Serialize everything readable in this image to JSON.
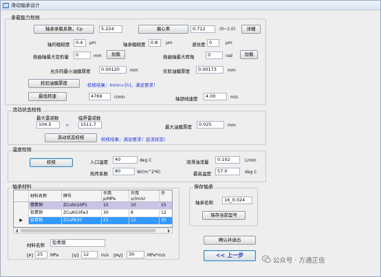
{
  "window": {
    "title": "滑动轴承设计"
  },
  "load": {
    "group_title": "承载能力校核",
    "coef_button": "轴承承载系数，Cp",
    "coef_value": "5.224",
    "ecc_button": "偏心率",
    "ecc_value": "0.712",
    "ecc_range": "(0~1.0)",
    "detail_button": "详细",
    "shaft_rough_label": "轴的粗糙度",
    "shaft_rough_value": "0.4",
    "shaft_rough_unit": "μm",
    "bore_rough_label": "轴承粗糙度",
    "bore_rough_value": "0.8",
    "bore_rough_unit": "μm",
    "wave_label": "波纹度",
    "wave_value": "0",
    "wave_unit": "μm",
    "deform_label": "挠曲轴最大变形量",
    "deform_value": "0",
    "deform_unit": "mm",
    "deform_button": "加载",
    "tilt_label": "挠曲轴最大转角",
    "tilt_value": "0",
    "tilt_unit": "rad",
    "tilt_button": "加载",
    "hmin_allow_label": "允许的最小油膜厚度",
    "hmin_allow_value": "0.00120",
    "hmin_allow_unit": "mm",
    "hmin_actual_label": "实际油膜厚度",
    "hmin_actual_value": "0.00173",
    "hmin_actual_unit": "mm",
    "check_button": "校验油膜厚度",
    "check_result": "校核结果：hmin>[h]，满足要求！",
    "min_speed_button": "最低转速",
    "min_speed_value": "4769",
    "min_speed_unit": "r/min",
    "neck_speed_label": "轴颈线速度",
    "neck_speed_value": "4.00",
    "neck_speed_unit": "m/s"
  },
  "flow": {
    "group_title": "流动状态校核",
    "re_max_label": "最大雷诺数",
    "re_max_value": "104.5",
    "lt_sign": "<",
    "re_crit_label": "临界雷诺数",
    "re_crit_value": "1511.7",
    "film_max_label": "最大油膜厚度",
    "film_max_value": "0.025",
    "film_max_unit": "mm",
    "check_button": "流动状态校核",
    "check_result": "校核结果：满足要求！层流状态！"
  },
  "temp": {
    "group_title": "温度校核",
    "check_button": "校核",
    "inlet_label": "入口温度",
    "inlet_value": "40",
    "inlet_unit": "deg C",
    "lube_flow_label": "润滑油流量",
    "lube_flow_value": "0.102",
    "lube_flow_unit": "L/min",
    "heat_coef_label": "热传系数",
    "heat_coef_value": "80",
    "heat_coef_unit": "W/(m^2*K)",
    "max_temp_label": "最高温度",
    "max_temp_value": "57.0",
    "max_temp_unit": "deg C"
  },
  "material": {
    "group_title": "轴承材料",
    "columns": [
      "材料名称",
      "牌号",
      "许用\np/MPa",
      "许用\nv/(m/s)",
      "许"
    ],
    "rows": [
      {
        "marker": "",
        "name": "锡青铜",
        "grade": "ZCuSn10P1",
        "p": "15",
        "v": "10",
        "extra": "15"
      },
      {
        "marker": "",
        "name": "铝青铜",
        "grade": "ZCuAl10Fe3",
        "p": "30",
        "v": "8",
        "extra": "12"
      },
      {
        "marker": "▶",
        "name": "铅青铜",
        "grade": "ZCuPb30",
        "p": "25",
        "v": "12",
        "extra": "30"
      }
    ],
    "name_label": "材料名称",
    "name_value": "铅青铜",
    "p_label": "[P]",
    "p_value": "25",
    "p_unit": "MPa",
    "v_label": "[V]",
    "v_value": "12",
    "v_unit": "m/s",
    "pv_label": "[PV]",
    "pv_value": "30",
    "pv_unit": "MPa*m/s"
  },
  "save": {
    "group_title": "保存轴承",
    "name_label": "轴承名称",
    "name_value": "16_0.024",
    "save_button": "保存当前型号"
  },
  "footer": {
    "confirm_button": "确认并退出",
    "back_button": "<< 上一步"
  },
  "watermark": {
    "text": "公众号 · 方通正信"
  }
}
